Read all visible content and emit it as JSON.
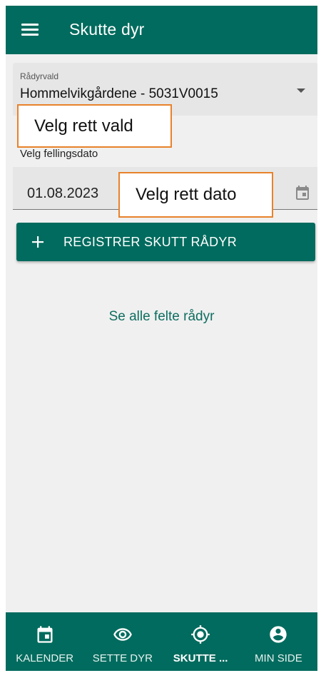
{
  "app_bar": {
    "title": "Skutte dyr",
    "menu_icon": "menu-icon"
  },
  "radyrvald": {
    "label": "Rådyrvald",
    "value": "Hommelvikgårdene - 5031V0015",
    "arrow_icon": "dropdown-arrow-icon"
  },
  "annotations": {
    "vald": "Velg rett vald",
    "dato": "Velg rett dato",
    "border_color": "#e8822a"
  },
  "fellingsdato": {
    "label": "Velg fellingsdato",
    "value": "01.08.2023",
    "icon": "calendar-icon"
  },
  "register_button": {
    "label": "REGISTRER SKUTT RÅDYR",
    "icon": "plus-icon"
  },
  "link_all": "Se alle felte rådyr",
  "bottom_nav": {
    "items": [
      {
        "label": "KALENDER",
        "icon": "calendar-icon",
        "active": false
      },
      {
        "label": "SETTE DYR",
        "icon": "eye-icon",
        "active": false
      },
      {
        "label": "SKUTTE ...",
        "icon": "crosshair-icon",
        "active": true
      },
      {
        "label": "MIN SIDE",
        "icon": "account-icon",
        "active": false
      }
    ]
  },
  "colors": {
    "primary": "#006b5e",
    "background": "#f0f0f0",
    "field": "#e6e6e6"
  }
}
